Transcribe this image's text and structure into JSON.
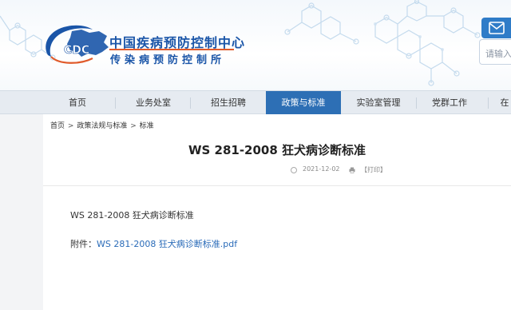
{
  "header": {
    "logo_text": "CDC",
    "org_name": "中国疾病预防控制中心",
    "org_sub": "传染病预防控制所",
    "search_placeholder": "请输入关",
    "mail_icon": "envelope-icon",
    "colors": {
      "brand_blue": "#1a55a8",
      "accent_orange": "#e05a2a"
    }
  },
  "nav": {
    "items": [
      {
        "label": "首页"
      },
      {
        "label": "业务处室"
      },
      {
        "label": "招生招聘"
      },
      {
        "label": "政策与标准"
      },
      {
        "label": "实验室管理"
      },
      {
        "label": "党群工作"
      },
      {
        "label": "在"
      }
    ],
    "active_index": 3,
    "active_color": "#2d6fb5"
  },
  "breadcrumb": {
    "items": [
      "首页",
      "政策法规与标准",
      "标准"
    ],
    "separator": ">"
  },
  "article": {
    "title": "WS 281-2008 狂犬病诊断标准",
    "date": "2021-12-02",
    "print_label": "【打印】",
    "body": "WS 281-2008 狂犬病诊断标准",
    "attachment_label": "附件：",
    "attachment_link": "WS 281-2008 狂犬病诊断标准.pdf"
  }
}
